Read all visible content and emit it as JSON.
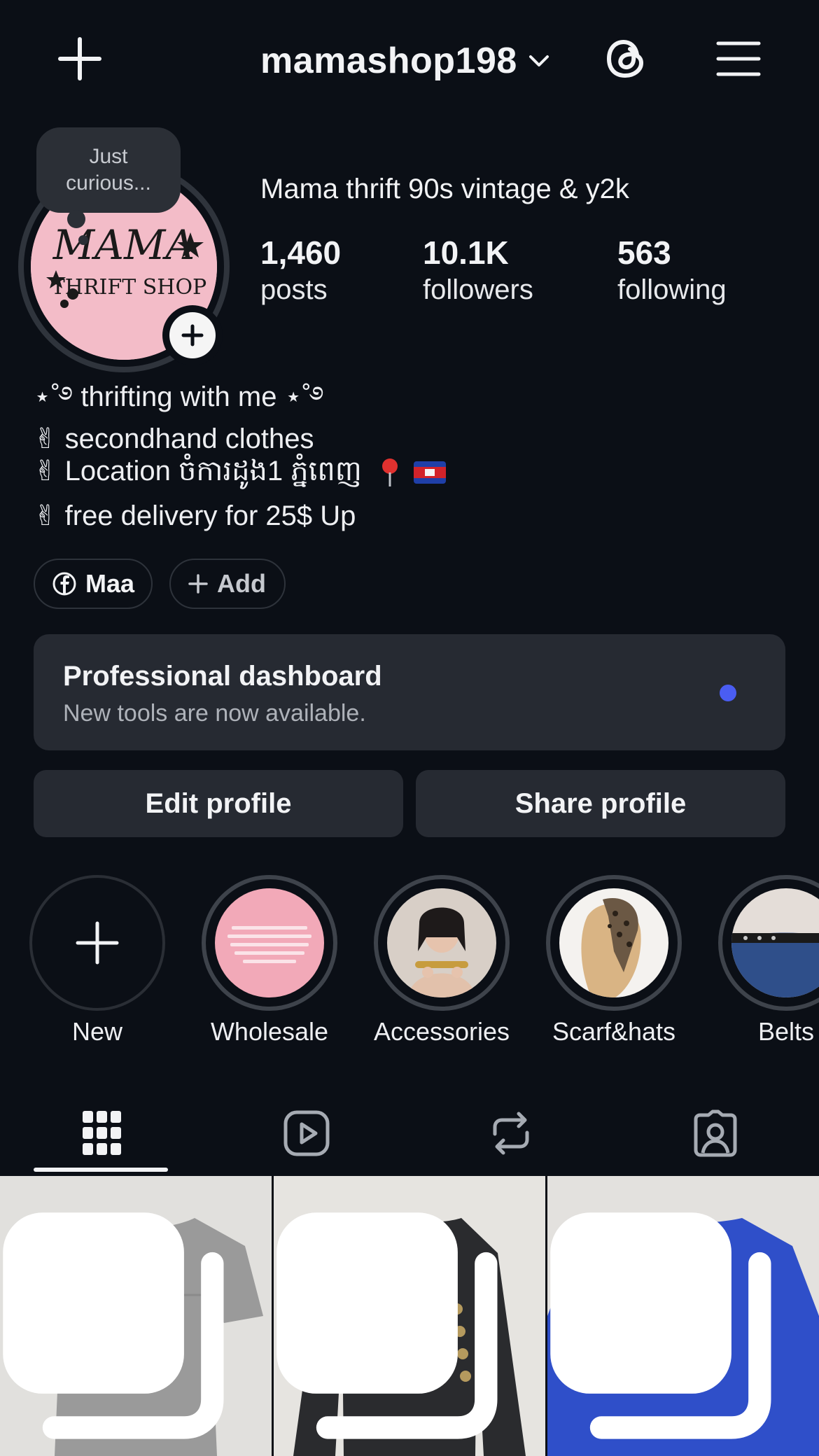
{
  "topbar": {
    "username": "mamashop198"
  },
  "profile": {
    "note": "Just curious...",
    "display_name": "Mama thrift 90s vintage & y2k",
    "stats": [
      {
        "value": "1,460",
        "label": "posts"
      },
      {
        "value": "10.1K",
        "label": "followers"
      },
      {
        "value": "563",
        "label": "following"
      }
    ],
    "avatar_text": {
      "line1": "MAMA",
      "line2": "THRIFT SHOP"
    }
  },
  "bio": {
    "line1": "⋆˚࿔ thrifting with me ⋆˚࿔",
    "line2": "✌︎ secondhand clothes",
    "line3": "✌︎ Location ចំការដូង1 ភ្នំពេញ",
    "line4": "✌︎ free delivery for 25$ Up"
  },
  "links": {
    "facebook_label": "Maa",
    "add_label": "Add"
  },
  "dashboard": {
    "title": "Professional dashboard",
    "subtitle": "New tools are now available."
  },
  "buttons": {
    "edit": "Edit profile",
    "share": "Share profile"
  },
  "highlights": [
    {
      "label": "New"
    },
    {
      "label": "Wholesale"
    },
    {
      "label": "Accessories"
    },
    {
      "label": "Scarf&hats"
    },
    {
      "label": "Belts"
    }
  ],
  "tabs": [
    "grid-icon",
    "reels-icon",
    "reposts-icon",
    "tagged-icon"
  ],
  "colors": {
    "background": "#0b0f16",
    "surface": "#262a32",
    "accent_dot": "#4a5df2",
    "avatar_pink": "#f3bcc8"
  }
}
